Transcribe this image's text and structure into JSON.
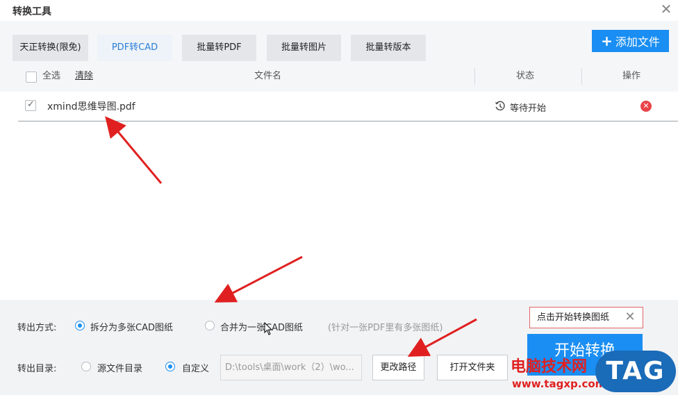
{
  "window": {
    "title": "转换工具"
  },
  "tabs": [
    {
      "label": "天正转换(限免)"
    },
    {
      "label": "PDF转CAD"
    },
    {
      "label": "批量转PDF"
    },
    {
      "label": "批量转图片"
    },
    {
      "label": "批量转版本"
    }
  ],
  "add_file_label": "添加文件",
  "header": {
    "select_all": "全选",
    "clear": "清除",
    "filename": "文件名",
    "status": "状态",
    "action": "操作"
  },
  "files": [
    {
      "name": "xmind思维导图.pdf",
      "status": "等待开始",
      "checked": true
    }
  ],
  "output_mode": {
    "label": "转出方式:",
    "options": [
      "拆分为多张CAD图纸",
      "合并为一张CAD图纸"
    ],
    "selected": "拆分为多张CAD图纸",
    "hint": "(针对一张PDF里有多张图纸)"
  },
  "output_dir": {
    "label": "转出目录:",
    "options": [
      "源文件目录",
      "自定义"
    ],
    "selected": "自定义",
    "path": "D:\\tools\\桌面\\work（2）\\wo..."
  },
  "buttons": {
    "change_path": "更改路径",
    "open_folder": "打开文件夹",
    "start": "开始转换"
  },
  "tooltip": "点击开始转换图纸",
  "watermark": {
    "site_name": "电脑技术网",
    "url": "www.tagxp.com",
    "tag": "TAG"
  },
  "colors": {
    "accent": "#1a8ef2",
    "danger": "#e9434a",
    "annotation_arrow": "#e02020"
  }
}
